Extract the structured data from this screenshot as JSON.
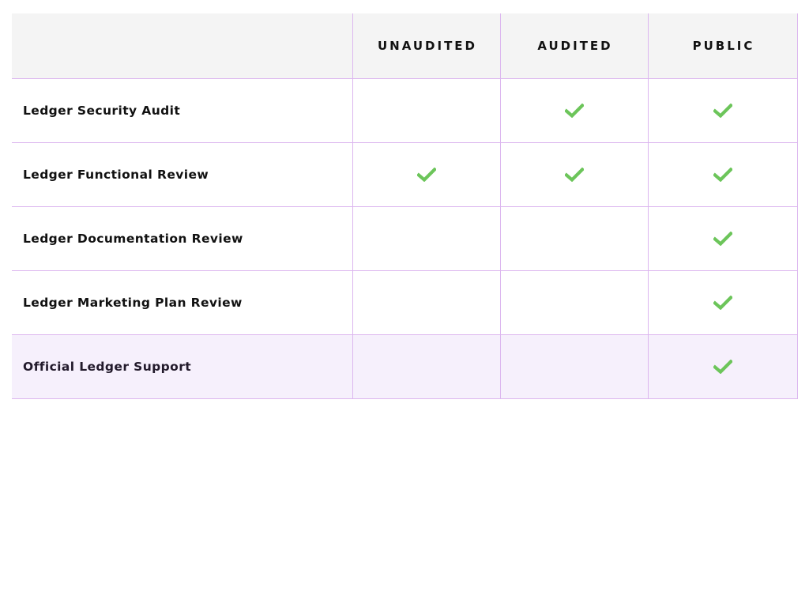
{
  "table": {
    "columns": [
      "",
      "UNAUDITED",
      "AUDITED",
      "PUBLIC"
    ],
    "rows": [
      {
        "label": "Ledger Security Audit",
        "checks": [
          false,
          true,
          true
        ]
      },
      {
        "label": "Ledger Functional Review",
        "checks": [
          true,
          true,
          true
        ]
      },
      {
        "label": "Ledger Documentation Review",
        "checks": [
          false,
          false,
          true
        ]
      },
      {
        "label": "Ledger Marketing Plan Review",
        "checks": [
          false,
          false,
          true
        ]
      },
      {
        "label": "Official Ledger Support",
        "checks": [
          false,
          false,
          true
        ]
      }
    ],
    "check_icon": "checkmark-icon",
    "colors": {
      "check": "#6cc55a",
      "border": "#dcb6ef",
      "header_bg": "#f4f4f4",
      "highlight_bg": "#f6f0fc"
    }
  }
}
